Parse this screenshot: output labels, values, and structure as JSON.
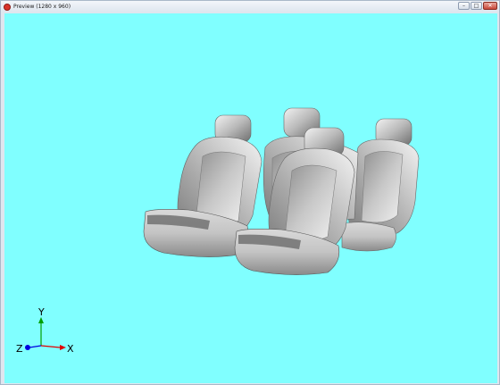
{
  "window": {
    "title": "Preview (1280 x 960)",
    "controls": {
      "minimize": "–",
      "maximize": "□",
      "close": "✕"
    }
  },
  "viewport": {
    "background_color": "#80ffff",
    "model": "car-seats-3d",
    "axes": {
      "x_label": "X",
      "y_label": "Y",
      "z_label": "Z",
      "x_color": "#e00000",
      "y_color": "#00a000",
      "z_color": "#0000e0"
    }
  }
}
